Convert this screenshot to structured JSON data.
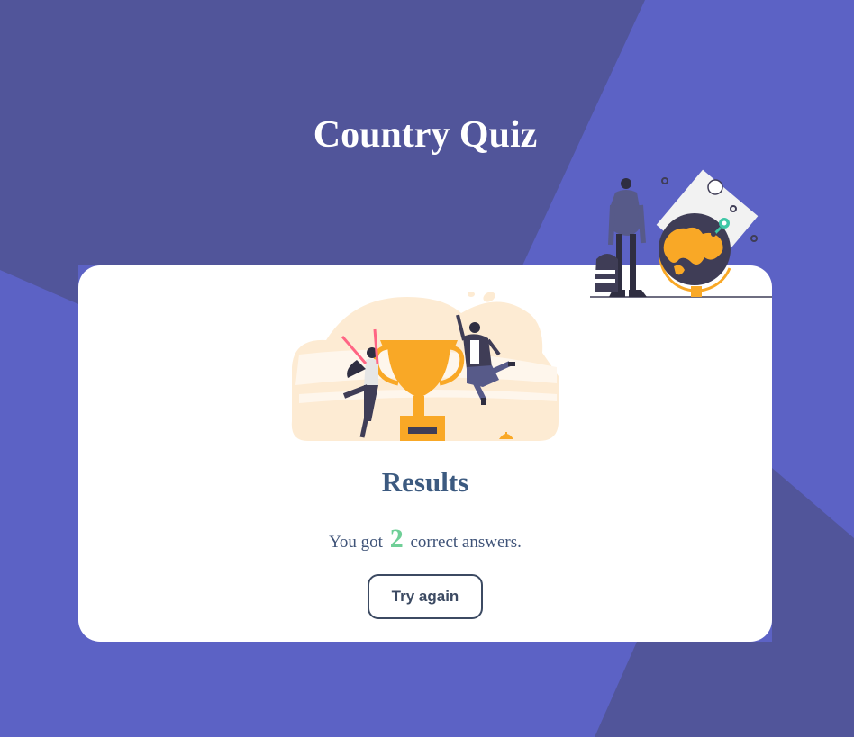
{
  "app": {
    "title": "Country Quiz"
  },
  "results": {
    "heading": "Results",
    "score_prefix": "You got",
    "score_value": "2",
    "score_suffix": "correct answers.",
    "try_again_label": "Try again"
  },
  "colors": {
    "background": "#5c62c5",
    "background_dark_shape": "#51559a",
    "card": "#ffffff",
    "heading_text": "#3c5a80",
    "score_accent": "#6fcf97",
    "button_border": "#3c4a62",
    "trophy_gold": "#f9a826"
  },
  "illustrations": {
    "header_art": "traveler-with-globe-illustration",
    "results_art": "winners-with-trophy-illustration"
  }
}
